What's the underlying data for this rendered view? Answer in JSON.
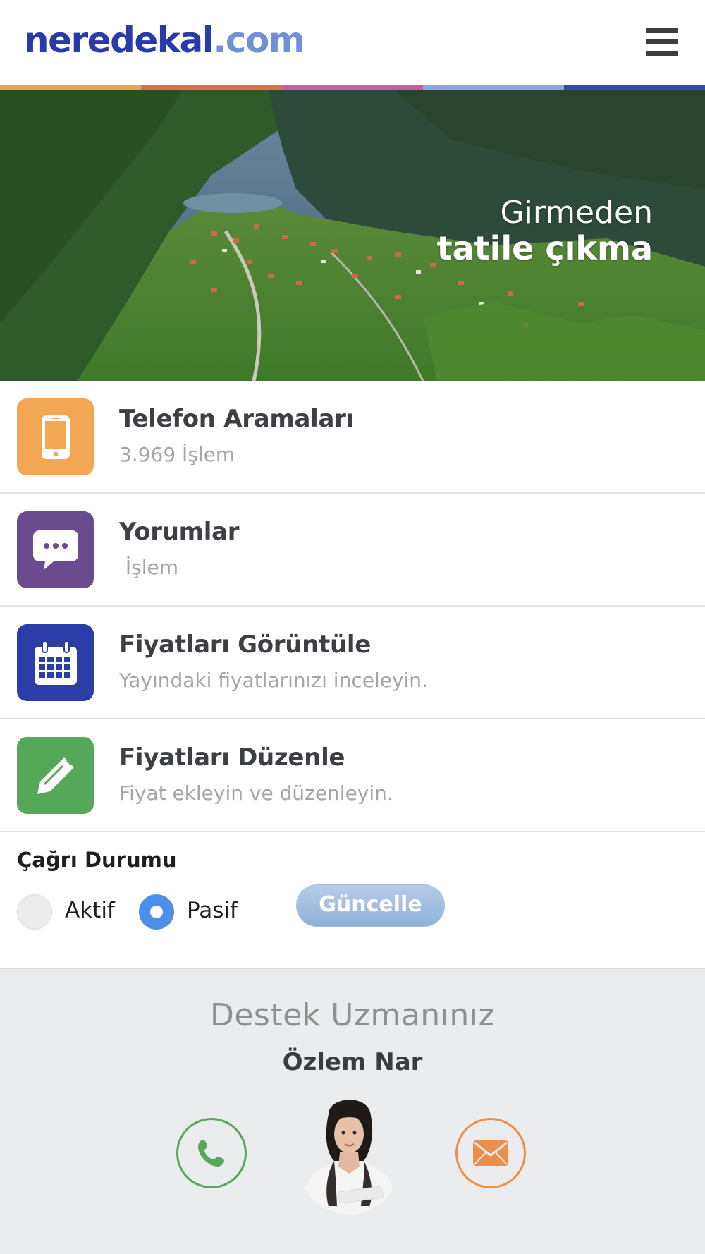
{
  "header": {
    "logo_brand": "neredekal",
    "logo_tld": ".com",
    "menu_icon": "hamburger-menu-icon"
  },
  "stripe_colors": [
    "#f0a44a",
    "#e06b55",
    "#cc5b9e",
    "#8fa6d9",
    "#3347b6"
  ],
  "hero": {
    "line1": "Girmeden",
    "line2": "tatile çıkma"
  },
  "menu": {
    "items": [
      {
        "title": "Telefon Aramaları",
        "subtitle": "3.969 İşlem",
        "icon": "mobile-phone-icon",
        "color": "#f3a654"
      },
      {
        "title": "Yorumlar",
        "subtitle": " İşlem",
        "icon": "chat-bubble-icon",
        "color": "#6a4b8e"
      },
      {
        "title": "Fiyatları Görüntüle",
        "subtitle": "Yayındaki fiyatlarınızı inceleyin.",
        "icon": "calendar-icon",
        "color": "#2c3da7"
      },
      {
        "title": "Fiyatları Düzenle",
        "subtitle": "Fiyat ekleyin ve düzenleyin.",
        "icon": "pencil-icon",
        "color": "#55a85a"
      }
    ]
  },
  "call_status": {
    "title": "Çağrı Durumu",
    "options": [
      {
        "label": "Aktif",
        "selected": false
      },
      {
        "label": "Pasif",
        "selected": true
      }
    ],
    "button": "Güncelle"
  },
  "support": {
    "title": "Destek Uzmanınız",
    "name": "Özlem Nar",
    "phone_icon": "phone-icon",
    "mail_icon": "envelope-icon"
  }
}
